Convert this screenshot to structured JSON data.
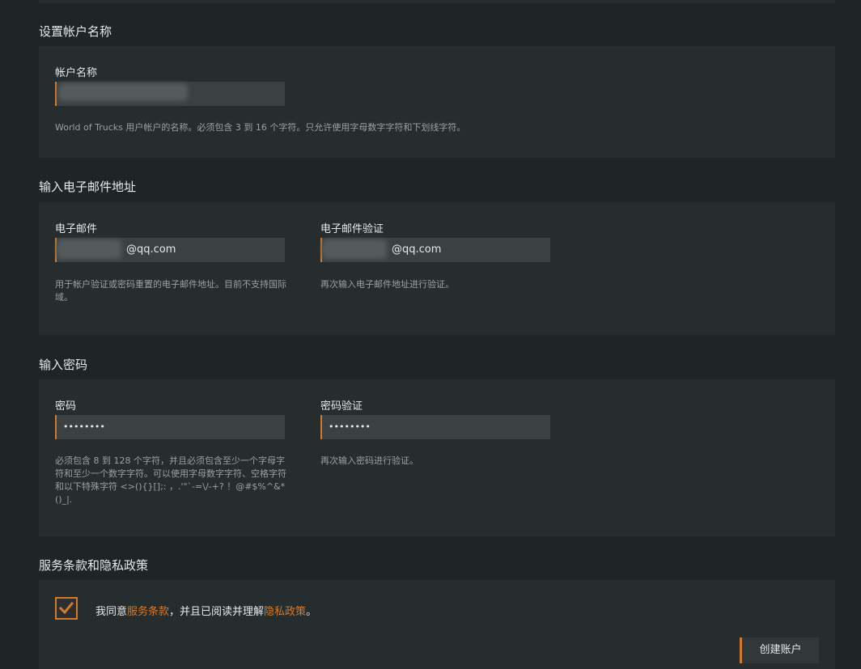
{
  "sections": {
    "account": {
      "title": "设置帐户名称",
      "field_label": "帐户名称",
      "help": "World of Trucks 用户帐户的名称。必须包含 3 到 16 个字符。只允许使用字母数字字符和下划线字符。"
    },
    "email": {
      "title": "输入电子邮件地址",
      "email_label": "电子邮件",
      "email_value": "@qq.com",
      "email_help": "用于帐户验证或密码重置的电子邮件地址。目前不支持国际域。",
      "confirm_label": "电子邮件验证",
      "confirm_value": "@qq.com",
      "confirm_help": "再次输入电子邮件地址进行验证。"
    },
    "password": {
      "title": "输入密码",
      "password_label": "密码",
      "password_value": "••••••••",
      "password_help": "必须包含 8 到 128 个字符，并且必须包含至少一个字母字符和至少一个数字字符。可以使用字母数字字符、空格字符和以下特殊字符 <>(){}[];: ，.'\"`-=\\/-+? ！@#$%^&*()_|.",
      "confirm_label": "密码验证",
      "confirm_value": "••••••••",
      "confirm_help": "再次输入密码进行验证。"
    },
    "terms": {
      "title": "服务条款和隐私政策",
      "agree_prefix": "我同意",
      "tos_link": "服务条款",
      "agree_middle": "，并且已阅读并理解",
      "privacy_link": "隐私政策",
      "agree_suffix": "。",
      "checked": true,
      "checkbox_icon": "checkmark-icon"
    }
  },
  "actions": {
    "create_label": "创建账户"
  },
  "colors": {
    "accent": "#d27a2c",
    "panel": "#262d2f",
    "background": "#1e2526",
    "input": "#3b4142"
  }
}
